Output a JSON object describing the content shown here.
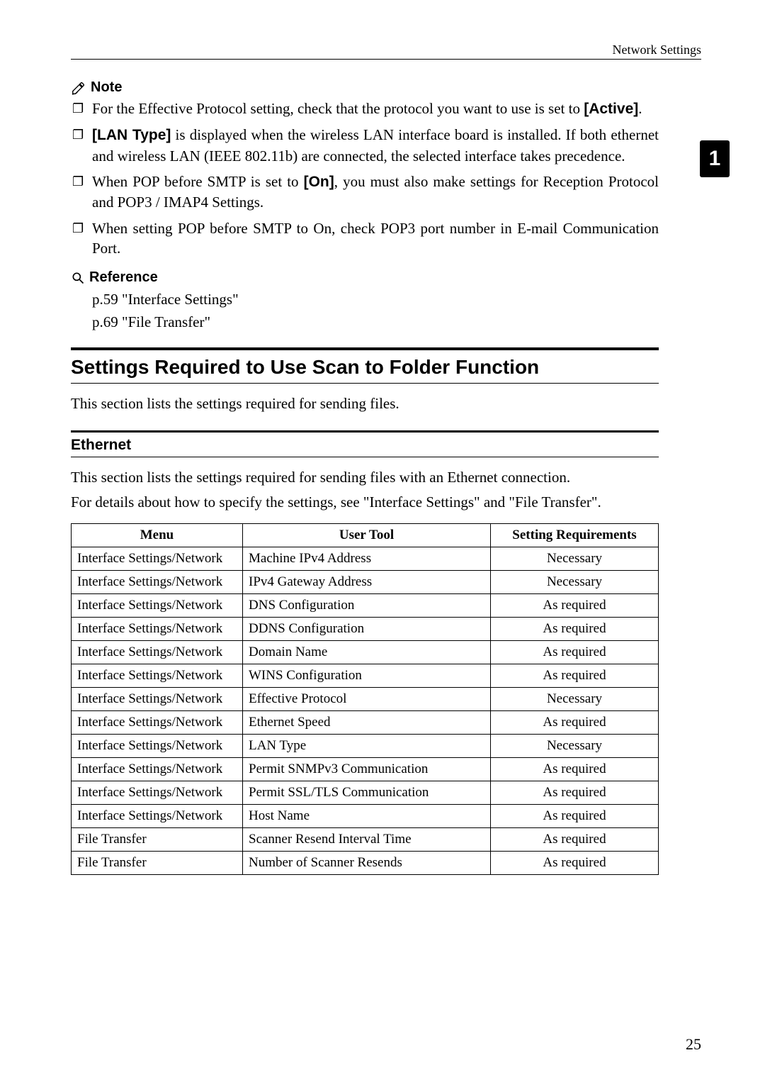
{
  "header": {
    "title": "Network Settings"
  },
  "side_tab": "1",
  "note": {
    "heading": "Note",
    "items": [
      {
        "pre": "For the Effective Protocol setting, check that the protocol you want to use is set to ",
        "bold": "[Active]",
        "post": "."
      },
      {
        "bold_lead": "[LAN Type]",
        "post": " is displayed when the wireless LAN interface board is installed. If both ethernet and wireless LAN (IEEE 802.11b) are connected, the selected interface takes precedence."
      },
      {
        "pre": "When POP before SMTP is set to ",
        "bold": "[On]",
        "post": ", you must also make settings for Reception Protocol and POP3 / IMAP4 Settings."
      },
      {
        "plain": "When setting POP before SMTP to On, check POP3 port number in E-mail Communication Port."
      }
    ]
  },
  "reference": {
    "heading": "Reference",
    "items": [
      "p.59 \"Interface Settings\"",
      "p.69 \"File Transfer\""
    ]
  },
  "h2": {
    "title": "Settings Required to Use Scan to Folder Function",
    "intro": "This section lists the settings required for sending files."
  },
  "h3": {
    "title": "Ethernet",
    "p1": "This section lists the settings required for sending files with an Ethernet connection.",
    "p2": "For details about how to specify the settings, see \"Interface Settings\" and \"File Transfer\"."
  },
  "table": {
    "headers": {
      "menu": "Menu",
      "tool": "User Tool",
      "req": "Setting Requirements"
    },
    "rows": [
      {
        "menu": "Interface Settings/Network",
        "tool": "Machine IPv4 Address",
        "req": "Necessary"
      },
      {
        "menu": "Interface Settings/Network",
        "tool": "IPv4 Gateway Address",
        "req": "Necessary"
      },
      {
        "menu": "Interface Settings/Network",
        "tool": "DNS Configuration",
        "req": "As required"
      },
      {
        "menu": "Interface Settings/Network",
        "tool": "DDNS Configuration",
        "req": "As required"
      },
      {
        "menu": "Interface Settings/Network",
        "tool": "Domain Name",
        "req": "As required"
      },
      {
        "menu": "Interface Settings/Network",
        "tool": "WINS Configuration",
        "req": "As required"
      },
      {
        "menu": "Interface Settings/Network",
        "tool": "Effective Protocol",
        "req": "Necessary"
      },
      {
        "menu": "Interface Settings/Network",
        "tool": "Ethernet Speed",
        "req": "As required"
      },
      {
        "menu": "Interface Settings/Network",
        "tool": "LAN Type",
        "req": "Necessary"
      },
      {
        "menu": "Interface Settings/Network",
        "tool": "Permit SNMPv3 Communication",
        "req": "As required"
      },
      {
        "menu": "Interface Settings/Network",
        "tool": "Permit SSL/TLS Communication",
        "req": "As required"
      },
      {
        "menu": "Interface Settings/Network",
        "tool": "Host Name",
        "req": "As required"
      },
      {
        "menu": "File Transfer",
        "tool": "Scanner Resend Interval Time",
        "req": "As required"
      },
      {
        "menu": "File Transfer",
        "tool": "Number of Scanner Resends",
        "req": "As required"
      }
    ]
  },
  "page_number": "25"
}
